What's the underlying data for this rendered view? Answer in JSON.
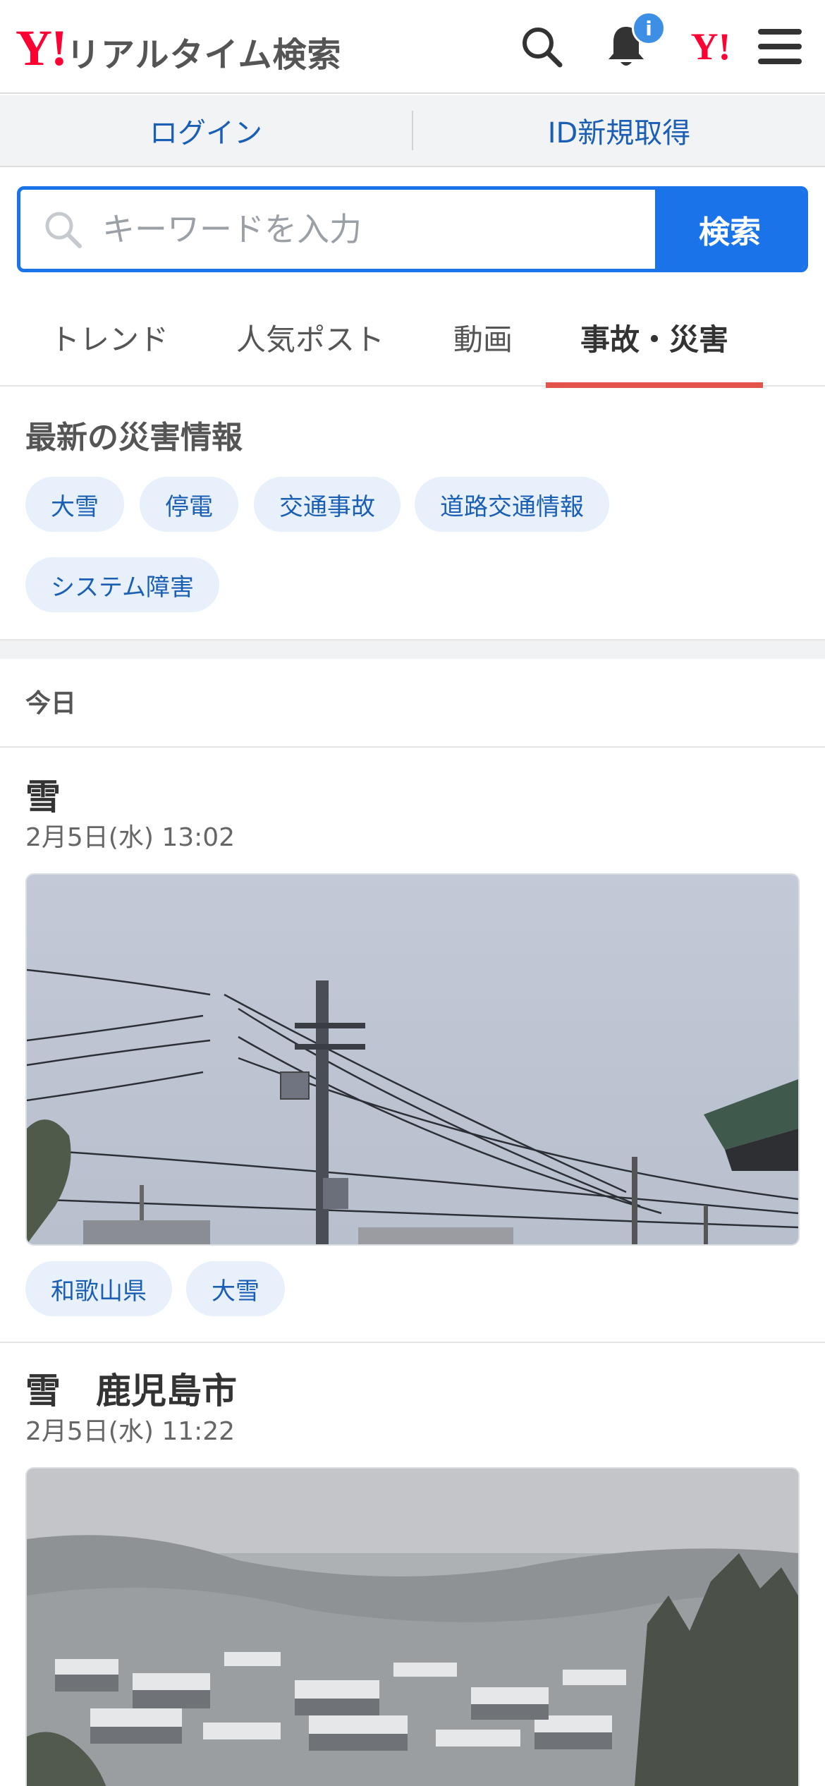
{
  "header": {
    "logo_mark": "Y!",
    "logo_text": "リアルタイム検索",
    "notification_badge": "i",
    "yahoo_mark": "Y!"
  },
  "login_bar": {
    "login_label": "ログイン",
    "register_label": "ID新規取得"
  },
  "search": {
    "placeholder": "キーワードを入力",
    "button_label": "検索"
  },
  "tabs": [
    {
      "label": "トレンド",
      "active": false
    },
    {
      "label": "人気ポスト",
      "active": false
    },
    {
      "label": "動画",
      "active": false
    },
    {
      "label": "事故・災害",
      "active": true
    }
  ],
  "disaster_info": {
    "title": "最新の災害情報",
    "chips": [
      "大雪",
      "停電",
      "交通事故",
      "道路交通情報",
      "システム障害"
    ]
  },
  "timeline": {
    "day_label": "今日",
    "posts": [
      {
        "title": "雪",
        "time": "2月5日(水) 13:02",
        "tags": [
          "和歌山県",
          "大雪"
        ]
      },
      {
        "title": "雪　鹿児島市",
        "time": "2月5日(水) 11:22",
        "tags": []
      }
    ]
  },
  "colors": {
    "accent_blue": "#1a73e8",
    "tab_underline": "#e2534b",
    "brand_red": "#ff0033",
    "chip_bg": "#e7f0fb",
    "chip_text": "#1a5fb4"
  }
}
